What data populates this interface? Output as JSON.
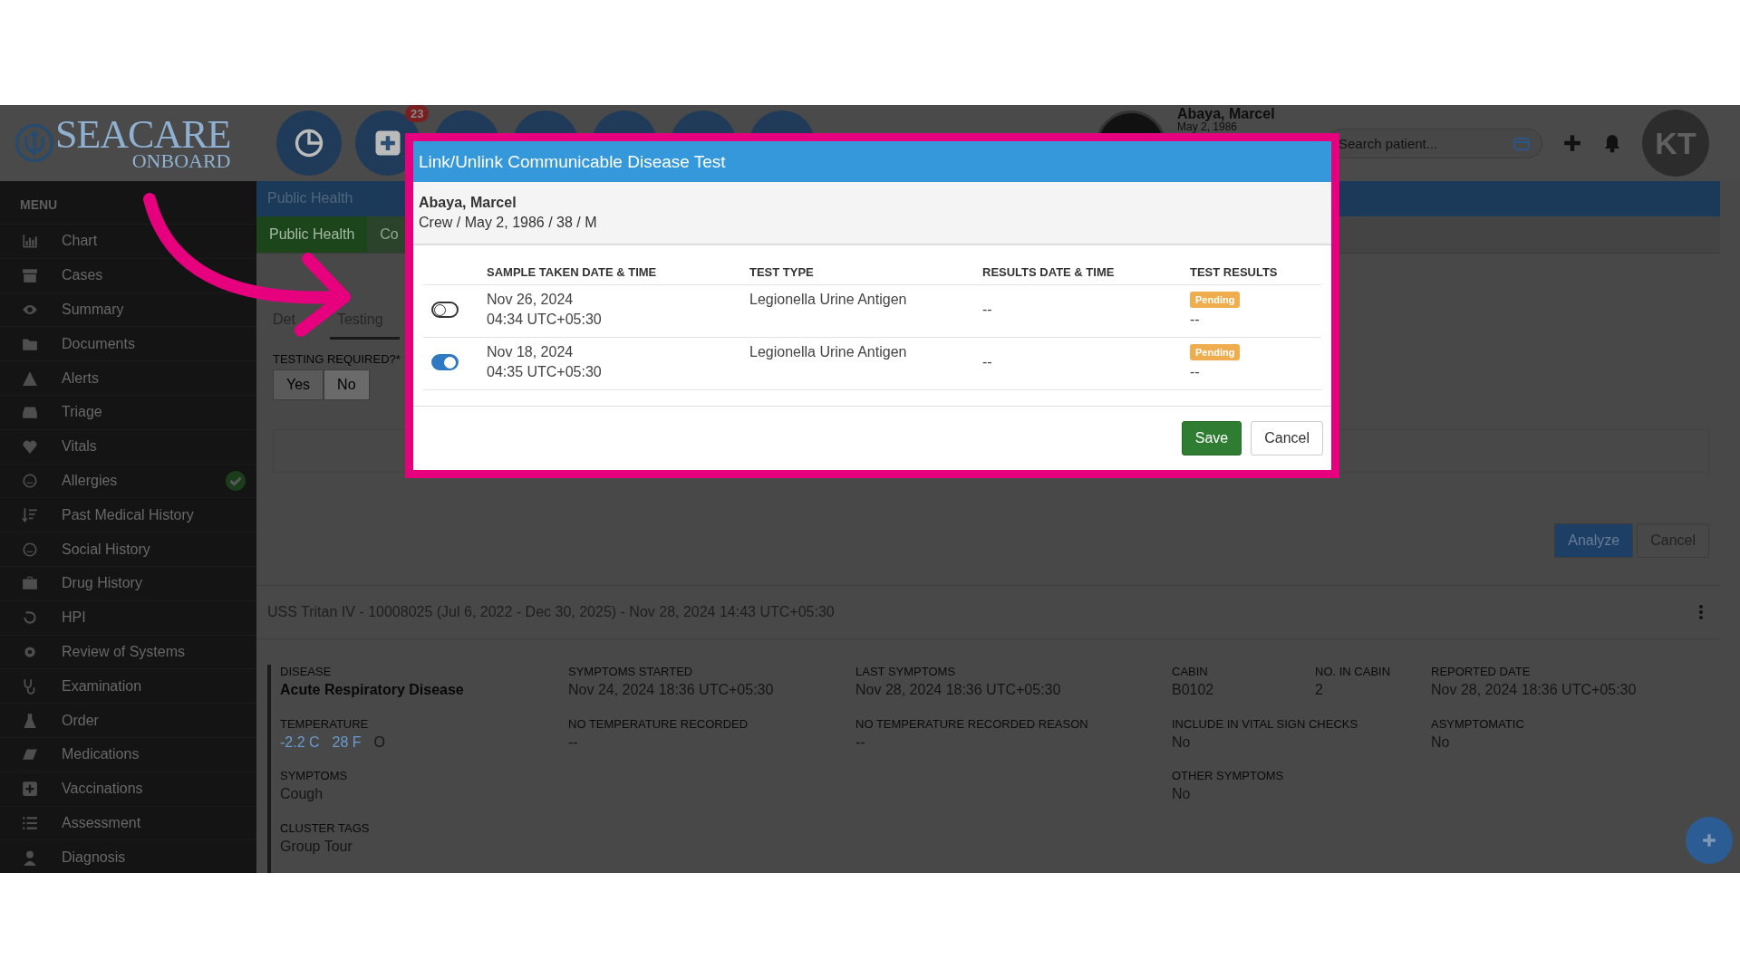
{
  "header": {
    "logo": {
      "name": "SEACARE",
      "tagline": "ONBOARD"
    },
    "nav_badge": "23",
    "patient": {
      "name": "Abaya, Marcel",
      "dob": "May 2, 1986"
    },
    "search": {
      "placeholder": "Search patient..."
    },
    "user_initials": "KT"
  },
  "sidebar": {
    "title": "MENU",
    "items": [
      {
        "label": "Chart",
        "done": false
      },
      {
        "label": "Cases",
        "done": false
      },
      {
        "label": "Summary",
        "done": false
      },
      {
        "label": "Documents",
        "done": false
      },
      {
        "label": "Alerts",
        "done": false
      },
      {
        "label": "Triage",
        "done": false
      },
      {
        "label": "Vitals",
        "done": false
      },
      {
        "label": "Allergies",
        "done": true
      },
      {
        "label": "Past Medical History",
        "done": false
      },
      {
        "label": "Social History",
        "done": false
      },
      {
        "label": "Drug History",
        "done": false
      },
      {
        "label": "HPI",
        "done": false
      },
      {
        "label": "Review of Systems",
        "done": false
      },
      {
        "label": "Examination",
        "done": false
      },
      {
        "label": "Order",
        "done": false
      },
      {
        "label": "Medications",
        "done": false
      },
      {
        "label": "Vaccinations",
        "done": false
      },
      {
        "label": "Assessment",
        "done": false
      },
      {
        "label": "Diagnosis",
        "done": false
      }
    ]
  },
  "page": {
    "section_title": "Public Health",
    "tabs": [
      {
        "label": "Public Health",
        "selected": true
      },
      {
        "label": "Co",
        "selected": false
      }
    ],
    "subtabs": [
      {
        "label": "Det",
        "selected": false
      },
      {
        "label": "Testing",
        "selected": true
      }
    ],
    "testing_required": {
      "label": "TESTING REQUIRED?*",
      "options": [
        {
          "label": "Yes",
          "selected": false
        },
        {
          "label": "No",
          "selected": true
        }
      ]
    },
    "actions": [
      {
        "label": "Analyze",
        "kind": "primary"
      },
      {
        "label": "Cancel",
        "kind": "default"
      }
    ],
    "case": {
      "title": "USS Tritan IV - 10008025 (Jul 6, 2022 - Dec 30, 2025) - Nov 28, 2024 14:43 UTC+05:30",
      "columns": [
        [
          {
            "label": "DISEASE",
            "kind": "bold",
            "value": "Acute Respiratory Disease"
          },
          {
            "label": "TEMPERATURE",
            "kind": "temperature",
            "readings": [
              "-2.2 C",
              "28 F"
            ],
            "value": "O"
          },
          {
            "label": "SYMPTOMS",
            "kind": "text",
            "value": "Cough"
          },
          {
            "label": "CLUSTER TAGS",
            "kind": "text",
            "value": "Group Tour"
          }
        ],
        [
          {
            "label": "SYMPTOMS STARTED",
            "kind": "text",
            "value": "Nov 24, 2024 18:36 UTC+05:30"
          },
          {
            "label": "NO TEMPERATURE RECORDED",
            "kind": "text",
            "value": "--"
          }
        ],
        [
          {
            "label": "LAST SYMPTOMS",
            "kind": "text",
            "value": "Nov 28, 2024 18:36 UTC+05:30"
          },
          {
            "label": "NO TEMPERATURE RECORDED REASON",
            "kind": "text",
            "value": "--"
          }
        ],
        [
          {
            "label": "CABIN",
            "kind": "text",
            "value": "B0102"
          },
          {
            "label": "INCLUDE IN VITAL SIGN CHECKS",
            "kind": "text",
            "value": "No"
          },
          {
            "label": "OTHER SYMPTOMS",
            "kind": "text",
            "value": "No"
          }
        ],
        [
          {
            "label": "NO. IN CABIN",
            "kind": "text",
            "value": "2"
          }
        ],
        [
          {
            "label": "REPORTED DATE",
            "kind": "text",
            "value": "Nov 28, 2024 18:36 UTC+05:30"
          },
          {
            "label": "ASYMPTOMATIC",
            "kind": "text",
            "value": "No"
          }
        ]
      ]
    }
  },
  "modal": {
    "title": "Link/Unlink Communicable Disease Test",
    "patient": {
      "name": "Abaya, Marcel",
      "details": "Crew / May 2, 1986 / 38 / M"
    },
    "columns": [
      "SAMPLE TAKEN DATE & TIME",
      "TEST TYPE",
      "RESULTS DATE & TIME",
      "TEST RESULTS"
    ],
    "rows": [
      {
        "linked": false,
        "sample_date": "Nov 26, 2024",
        "sample_time": "04:34 UTC+05:30",
        "test_type": "Legionella Urine Antigen",
        "results_date": "--",
        "status": "Pending",
        "result": "--"
      },
      {
        "linked": true,
        "sample_date": "Nov 18, 2024",
        "sample_time": "04:35 UTC+05:30",
        "test_type": "Legionella Urine Antigen",
        "results_date": "--",
        "status": "Pending",
        "result": "--"
      }
    ],
    "buttons": [
      {
        "label": "Save",
        "kind": "primary"
      },
      {
        "label": "Cancel",
        "kind": "default"
      }
    ]
  }
}
